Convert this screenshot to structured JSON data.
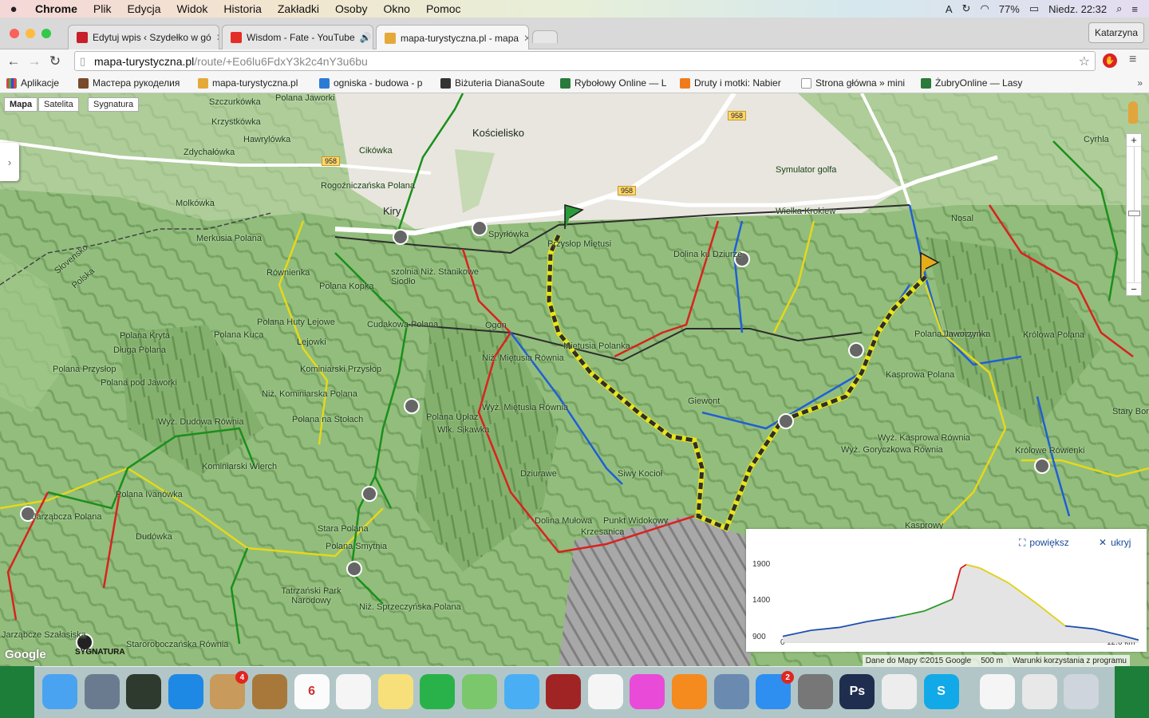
{
  "menubar": {
    "app": "Chrome",
    "items": [
      "Plik",
      "Edycja",
      "Widok",
      "Historia",
      "Zakładki",
      "Osoby",
      "Okno",
      "Pomoc"
    ],
    "battery": "77%",
    "clock": "Niedz. 22:32"
  },
  "tabs": [
    {
      "title": "Edytuj wpis ‹ Szydełko w gó",
      "close": "✕",
      "fav_color": "#c8202a"
    },
    {
      "title": "Wisdom - Fate - YouTube",
      "close": "✕",
      "fav_color": "#e52d27"
    },
    {
      "title": "mapa-turystyczna.pl - mapa",
      "close": "✕",
      "fav_color": "#e5a93a"
    }
  ],
  "profile": "Katarzyna",
  "address": {
    "host": "mapa-turystyczna.pl",
    "path": "/route/+Eo6lu6FdxY3k2c4nY3u6bu"
  },
  "bookmarks": [
    {
      "label": "Aplikacje",
      "color": "#d44"
    },
    {
      "label": "Мастера рукоделия",
      "color": "#7a4a2a"
    },
    {
      "label": "mapa-turystyczna.pl",
      "color": "#e5a93a"
    },
    {
      "label": "ogniska - budowa - p",
      "color": "#2a7bd6"
    },
    {
      "label": "Biżuteria DianaSoute",
      "color": "#333"
    },
    {
      "label": "Rybołowy Online — L",
      "color": "#2a7a3a"
    },
    {
      "label": "Druty i motki: Nabier",
      "color": "#f07b1c"
    },
    {
      "label": "Strona główna » mini",
      "color": "#888"
    },
    {
      "label": "ŻubryOnline — Lasy",
      "color": "#2a7a3a"
    }
  ],
  "map": {
    "types": [
      "Mapa",
      "Satelita",
      "Sygnatura"
    ],
    "places": [
      {
        "name": "Szczurkówka"
      },
      {
        "name": "Polana Jaworki"
      },
      {
        "name": "Krzystkówka"
      },
      {
        "name": "Hawrylówka"
      },
      {
        "name": "Kościelisko",
        "big": true
      },
      {
        "name": "Cikówka"
      },
      {
        "name": "Zdychałówka"
      },
      {
        "name": "Rogoźniczańska Polana"
      },
      {
        "name": "Molkówka"
      },
      {
        "name": "Kiry",
        "big": true
      },
      {
        "name": "Spyrłówka"
      },
      {
        "name": "Przysłop Miętusi"
      },
      {
        "name": "Dolina ku Dziurze"
      },
      {
        "name": "Wielka Krokiew"
      },
      {
        "name": "Symulator golfa"
      },
      {
        "name": "Nosal"
      },
      {
        "name": "Jaworzynka"
      },
      {
        "name": "Miętusia Polanka"
      },
      {
        "name": "Niż. Miętusia Równia"
      },
      {
        "name": "Ogon"
      },
      {
        "name": "Cudakowa Polana"
      },
      {
        "name": "Polana Kopka"
      },
      {
        "name": "Polana Huty Lejowe"
      },
      {
        "name": "Lejowki"
      },
      {
        "name": "Kominiarski Przysłop"
      },
      {
        "name": "Niż. Kominiarska Polana"
      },
      {
        "name": "Polana Jaworzynka"
      },
      {
        "name": "Królowa Polana"
      },
      {
        "name": "Kasprowa Polana"
      },
      {
        "name": "Giewont"
      },
      {
        "name": "Wyż. Miętusia Równia"
      },
      {
        "name": "Polana Upłaz"
      },
      {
        "name": "Wlk. Sikawka"
      },
      {
        "name": "Polana na Stołach"
      },
      {
        "name": "Wyż. Dudowa Równia"
      },
      {
        "name": "Kominiarski Wierch"
      },
      {
        "name": "Polana Ivanówka"
      },
      {
        "name": "Jarząbcza Polana"
      },
      {
        "name": "Dudówka"
      },
      {
        "name": "Dziurawe"
      },
      {
        "name": "Siwy Kocioł"
      },
      {
        "name": "Dolina Mułowa"
      },
      {
        "name": "Punkt Widokowy"
      },
      {
        "name": "Krzesanica"
      },
      {
        "name": "Stara Polana"
      },
      {
        "name": "Polana Smytnia"
      },
      {
        "name": "Tatrzański Park Narodowy"
      },
      {
        "name": "Niż. Sprzeczyńska Polana"
      },
      {
        "name": "Wyż. Kasprowa Równia"
      },
      {
        "name": "Wyż. Goryczkowa Równia"
      },
      {
        "name": "Królowe Rówienki"
      },
      {
        "name": "Stary Borek"
      },
      {
        "name": "Polana Przysłop"
      },
      {
        "name": "Polana Kryta"
      },
      {
        "name": "Długa Polana"
      },
      {
        "name": "Polana pod Jaworki"
      },
      {
        "name": "Merkusia Polana"
      },
      {
        "name": "Równienka"
      },
      {
        "name": "Polana Kuca"
      },
      {
        "name": "Jarząbcze Szałasiska"
      },
      {
        "name": "Staroroboczańska Równia"
      },
      {
        "name": "Cyrhla"
      },
      {
        "name": "Polska"
      },
      {
        "name": "Słovensko"
      },
      {
        "name": "szolnia Niż. Stanikowe Siodło"
      },
      {
        "name": "Kasprowy"
      }
    ],
    "roads": [
      "958",
      "958",
      "958"
    ],
    "elevation": {
      "actions": {
        "expand": "powiększ",
        "hide": "ukryj"
      },
      "y_ticks": [
        "1900",
        "1400",
        "900"
      ],
      "x_start": "0",
      "x_end": "12.6 km",
      "chart_data": {
        "type": "line",
        "x": [
          0,
          1,
          2,
          3,
          4,
          5,
          6,
          6.3,
          6.5,
          7,
          8,
          9,
          10,
          11,
          12,
          12.6
        ],
        "series": [
          {
            "values": [
              980,
              1060,
              1100,
              1180,
              1240,
              1320,
              1480,
              1900,
              1950,
              1900,
              1700,
              1420,
              1120,
              1080,
              990,
              930
            ]
          }
        ],
        "ylim": [
          900,
          2000
        ],
        "xlim": [
          0,
          12.6
        ]
      }
    },
    "footer": {
      "data": "Dane do Mapy ©2015 Google",
      "scale": "500 m",
      "terms": "Warunki korzystania z programu"
    },
    "logo": "Google",
    "sygnatura": "SYGNATURA"
  },
  "dock": {
    "apps": [
      {
        "name": "Finder",
        "color": "#4aa3f0"
      },
      {
        "name": "Launchpad",
        "color": "#6b7b8f"
      },
      {
        "name": "Mission Control",
        "color": "#2d3a2d"
      },
      {
        "name": "Safari",
        "color": "#1e88e5"
      },
      {
        "name": "Mail",
        "color": "#c89a5b",
        "badge": "4"
      },
      {
        "name": "Contacts",
        "color": "#a8783a"
      },
      {
        "name": "Calendar",
        "color": "#fbfbfb",
        "text": "6"
      },
      {
        "name": "Reminders",
        "color": "#f5f5f5"
      },
      {
        "name": "Notes",
        "color": "#f7e07a"
      },
      {
        "name": "FaceTime",
        "color": "#2ab24a"
      },
      {
        "name": "Maps",
        "color": "#7bc86c"
      },
      {
        "name": "Messages",
        "color": "#4aaef5"
      },
      {
        "name": "Photo Booth",
        "color": "#a12424"
      },
      {
        "name": "Photos",
        "color": "#f5f5f5"
      },
      {
        "name": "iTunes",
        "color": "#e94bd8"
      },
      {
        "name": "iBooks",
        "color": "#f58b1f"
      },
      {
        "name": "Preview",
        "color": "#6a8ab0"
      },
      {
        "name": "App Store",
        "color": "#2e8ff0",
        "badge": "2"
      },
      {
        "name": "System Preferences",
        "color": "#777"
      },
      {
        "name": "Photoshop",
        "color": "#1f2e4f",
        "text": "Ps"
      },
      {
        "name": "Chrome",
        "color": "#ededed"
      },
      {
        "name": "Skype",
        "color": "#12a9e8",
        "text": "S"
      },
      {
        "name": "Document",
        "color": "#f5f5f5"
      },
      {
        "name": "Screenshot",
        "color": "#e8e8e8"
      },
      {
        "name": "Trash",
        "color": "#cfd5dc"
      }
    ]
  }
}
